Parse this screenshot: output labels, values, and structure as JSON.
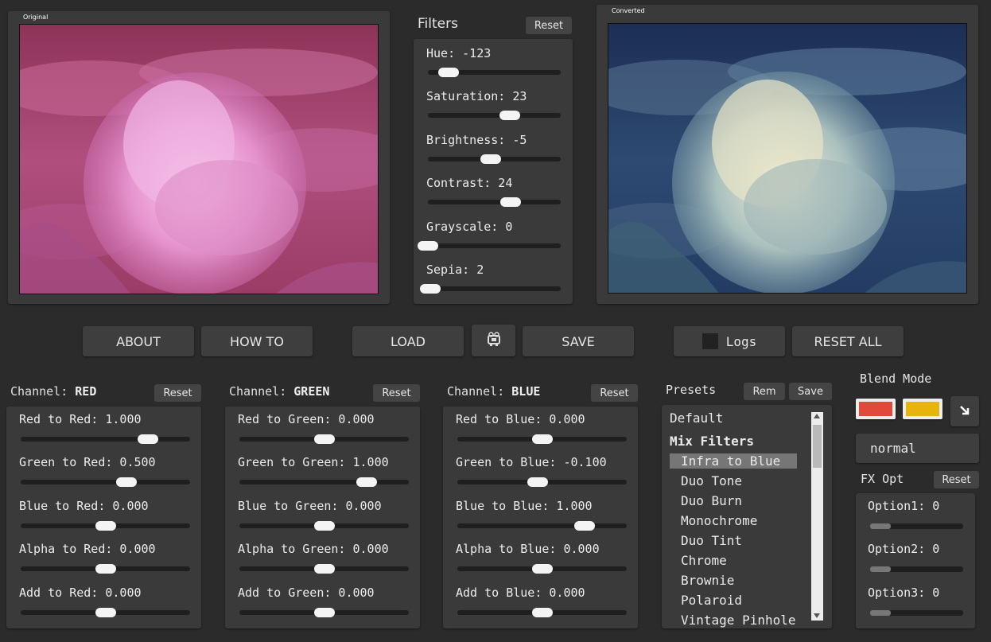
{
  "original": {
    "label": "Original"
  },
  "converted": {
    "label": "Converted"
  },
  "filters": {
    "title": "Filters",
    "reset_label": "Reset",
    "sliders": [
      {
        "label": "Hue: -123",
        "value": -123,
        "min": -180,
        "max": 180
      },
      {
        "label": "Saturation: 23",
        "value": 23,
        "min": -100,
        "max": 100
      },
      {
        "label": "Brightness: -5",
        "value": -5,
        "min": -100,
        "max": 100
      },
      {
        "label": "Contrast: 24",
        "value": 24,
        "min": -100,
        "max": 100
      },
      {
        "label": "Grayscale: 0",
        "value": 0,
        "min": 0,
        "max": 100
      },
      {
        "label": "Sepia: 2",
        "value": 2,
        "min": 0,
        "max": 100
      }
    ]
  },
  "toolbar": {
    "about_label": "ABOUT",
    "howto_label": "HOW TO",
    "load_label": "LOAD",
    "camera_icon": "camera-icon",
    "save_label": "SAVE",
    "logs_label": "Logs",
    "logs_checked": false,
    "resetall_label": "RESET ALL"
  },
  "channels": [
    {
      "prefix": "Channel: ",
      "name": "RED",
      "reset_label": "Reset",
      "sliders": [
        {
          "label": "Red to Red: 1.000",
          "value": 1.0,
          "min": -2,
          "max": 2
        },
        {
          "label": "Green to Red: 0.500",
          "value": 0.5,
          "min": -2,
          "max": 2
        },
        {
          "label": "Blue to Red: 0.000",
          "value": 0.0,
          "min": -2,
          "max": 2
        },
        {
          "label": "Alpha to Red: 0.000",
          "value": 0.0,
          "min": -1,
          "max": 1
        },
        {
          "label": "Add to Red: 0.000",
          "value": 0.0,
          "min": -1,
          "max": 1
        }
      ]
    },
    {
      "prefix": "Channel: ",
      "name": "GREEN",
      "reset_label": "Reset",
      "sliders": [
        {
          "label": "Red to Green: 0.000",
          "value": 0.0,
          "min": -2,
          "max": 2
        },
        {
          "label": "Green to Green: 1.000",
          "value": 1.0,
          "min": -2,
          "max": 2
        },
        {
          "label": "Blue to Green: 0.000",
          "value": 0.0,
          "min": -2,
          "max": 2
        },
        {
          "label": "Alpha to Green: 0.000",
          "value": 0.0,
          "min": -1,
          "max": 1
        },
        {
          "label": "Add to Green: 0.000",
          "value": 0.0,
          "min": -1,
          "max": 1
        }
      ]
    },
    {
      "prefix": "Channel: ",
      "name": "BLUE",
      "reset_label": "Reset",
      "sliders": [
        {
          "label": "Red to Blue: 0.000",
          "value": 0.0,
          "min": -2,
          "max": 2
        },
        {
          "label": "Green to Blue: -0.100",
          "value": -0.1,
          "min": -2,
          "max": 2
        },
        {
          "label": "Blue to Blue: 1.000",
          "value": 1.0,
          "min": -2,
          "max": 2
        },
        {
          "label": "Alpha to Blue: 0.000",
          "value": 0.0,
          "min": -1,
          "max": 1
        },
        {
          "label": "Add to Blue: 0.000",
          "value": 0.0,
          "min": -1,
          "max": 1
        }
      ]
    }
  ],
  "presets": {
    "title": "Presets",
    "rem_label": "Rem",
    "save_label": "Save",
    "items": [
      {
        "label": "Default",
        "kind": "item"
      },
      {
        "label": "Mix Filters",
        "kind": "header"
      },
      {
        "label": "Infra to Blue",
        "kind": "selected"
      },
      {
        "label": "Duo Tone",
        "kind": "sub"
      },
      {
        "label": "Duo Burn",
        "kind": "sub"
      },
      {
        "label": "Monochrome",
        "kind": "sub"
      },
      {
        "label": "Duo Tint",
        "kind": "sub"
      },
      {
        "label": "Chrome",
        "kind": "sub"
      },
      {
        "label": "Brownie",
        "kind": "sub"
      },
      {
        "label": "Polaroid",
        "kind": "sub"
      },
      {
        "label": "Vintage Pinhole",
        "kind": "sub"
      }
    ]
  },
  "blend": {
    "title": "Blend Mode",
    "color1": "#e04a3a",
    "color2": "#e8b40c",
    "swap_icon": "arrow-down-right-icon",
    "mode_value": "normal"
  },
  "fx": {
    "title": "FX Opt",
    "reset_label": "Reset",
    "options": [
      {
        "label": "Option1: 0",
        "value": 0
      },
      {
        "label": "Option2: 0",
        "value": 0
      },
      {
        "label": "Option3: 0",
        "value": 0
      }
    ]
  }
}
